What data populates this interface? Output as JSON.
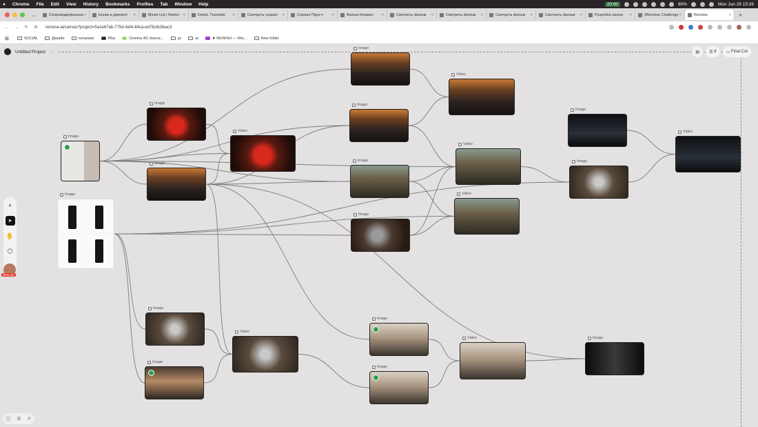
{
  "menubar": {
    "items": [
      "Chrome",
      "File",
      "Edit",
      "View",
      "History",
      "Bookmarks",
      "Profiles",
      "Tab",
      "Window",
      "Help"
    ],
    "time_badge": "20:00",
    "battery": "80%",
    "clock": "Mon Jun 29  15:26"
  },
  "tabs": [
    {
      "label": "Сопроводжувальна",
      "active": false
    },
    {
      "label": "Іконки в джерелі",
      "active": false
    },
    {
      "label": "Movie List | Notion",
      "active": false
    },
    {
      "label": "DeepL Translate",
      "active": false
    },
    {
      "label": "Смотреть сериал",
      "active": false
    },
    {
      "label": "Сериал Паук-ч",
      "active": false
    },
    {
      "label": "Фильм Нормал",
      "active": false
    },
    {
      "label": "Смотреть фильм",
      "active": false
    },
    {
      "label": "Смотреть фильм",
      "active": false
    },
    {
      "label": "Смотреть фильм",
      "active": false
    },
    {
      "label": "Смотреть фильм",
      "active": false
    },
    {
      "label": "Розробка оцінок",
      "active": false
    },
    {
      "label": "#Renoise Challenge",
      "active": false
    },
    {
      "label": "Renoise",
      "active": true
    }
  ],
  "address": {
    "url": "renoise.ai/canvas?project=5a1e67ab-775d-4af4-84ca-ed78c8c5bac3"
  },
  "bookmarks": [
    "SOCIAL",
    "Дизайн",
    "romanian",
    "Pika",
    "Cinema 4D Journe...",
    "pc",
    "ai",
    "★ REWISH — Wis...",
    "New folder"
  ],
  "project": {
    "name": "Untitled Project"
  },
  "topbar": {
    "count": "8",
    "export_label": "Final Cut"
  },
  "node_labels": {
    "image": "Image",
    "video": "Video"
  },
  "avatar_badge": "40%.am",
  "colors": {
    "canvas": "#e3e1e1",
    "edge": "#7d7b7c",
    "check": "#2e9e4a",
    "accent": "#e53935"
  }
}
